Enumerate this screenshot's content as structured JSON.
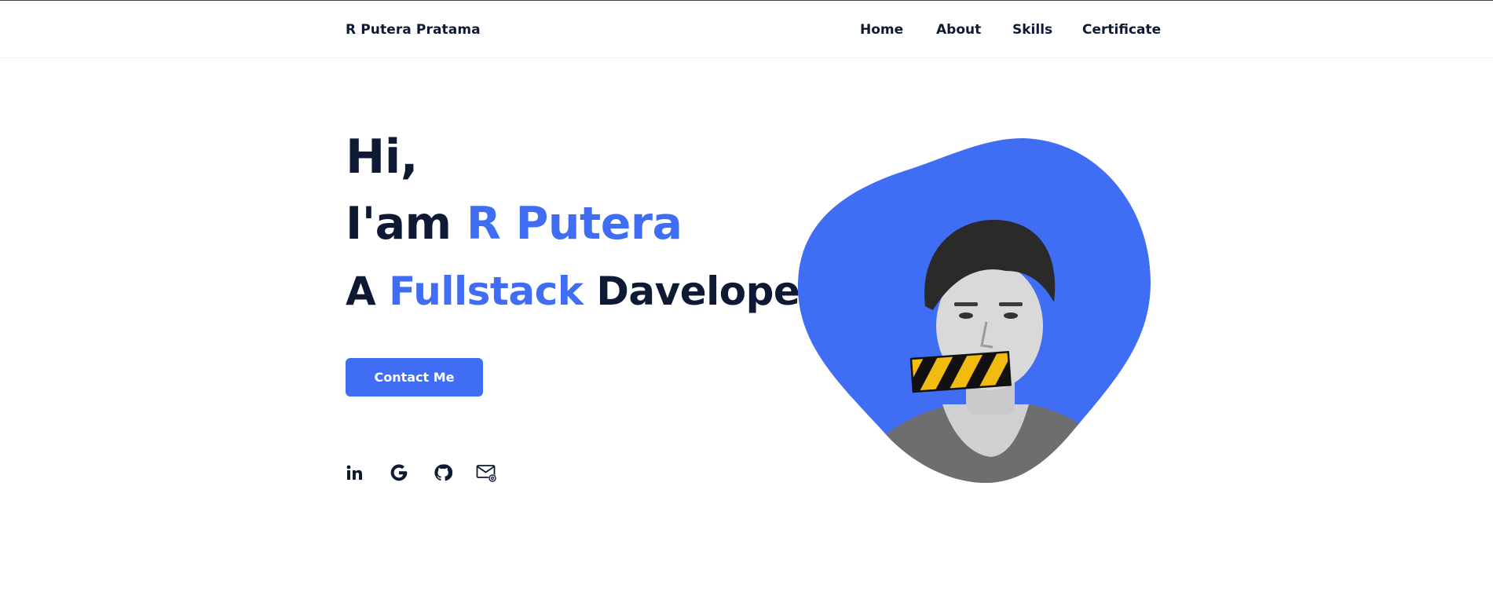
{
  "header": {
    "brand": "R Putera Pratama",
    "nav": [
      {
        "label": "Home"
      },
      {
        "label": "About"
      },
      {
        "label": "Skills"
      },
      {
        "label": "Certificate"
      }
    ]
  },
  "hero": {
    "greeting": "Hi,",
    "intro_prefix": "I'am",
    "name": "R Putera",
    "role_prefix": "A",
    "role_highlight": "Fullstack",
    "role_suffix": "Daveloper",
    "cta_label": "Contact Me"
  },
  "social": [
    {
      "icon": "linkedin-icon"
    },
    {
      "icon": "google-icon"
    },
    {
      "icon": "github-icon"
    },
    {
      "icon": "email-icon"
    }
  ],
  "colors": {
    "accent": "#3f6ef4",
    "text": "#0e1a34",
    "background": "#ffffff"
  }
}
